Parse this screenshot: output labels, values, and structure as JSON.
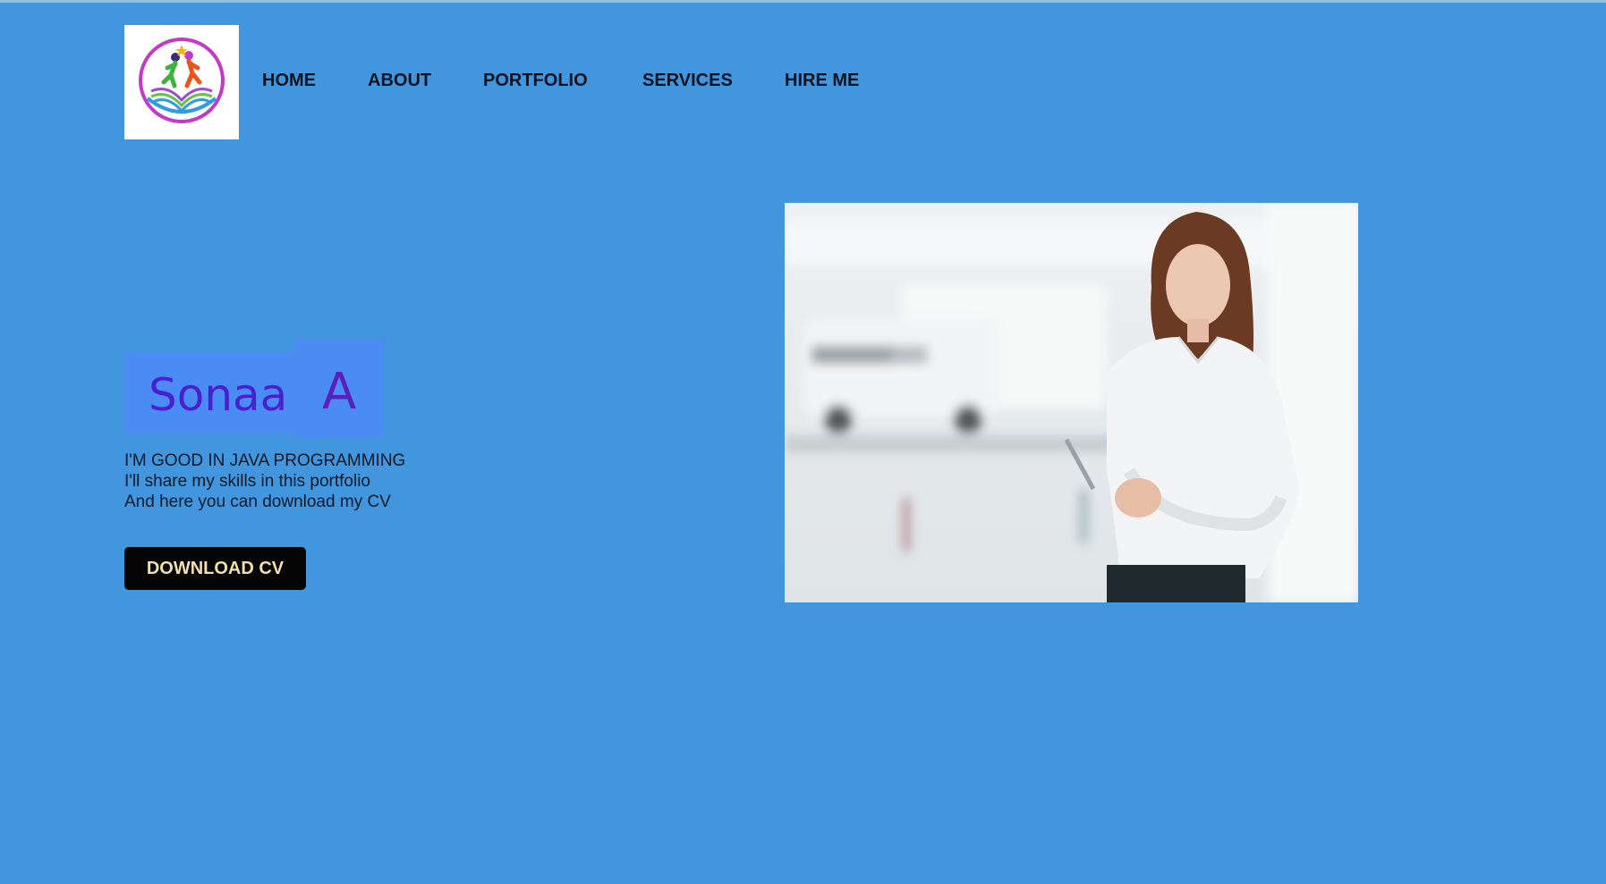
{
  "nav": {
    "items": [
      {
        "label": "HOME"
      },
      {
        "label": "ABOUT"
      },
      {
        "label": "PORTFOLIO"
      },
      {
        "label": "SERVICES"
      },
      {
        "label": "HIRE ME"
      }
    ]
  },
  "hero": {
    "first_name": "Sonaa",
    "last_name": "A",
    "tagline": [
      "I'M GOOD IN JAVA PROGRAMMING",
      "I'll share my skills in this portfolio",
      "And here you can download my CV"
    ],
    "cta_label": "DOWNLOAD CV"
  },
  "colors": {
    "background": "#4196de",
    "name_box": "#4a8cf4",
    "name_text": "#4a1fcf",
    "button_bg": "#050505",
    "button_text": "#f3dfae"
  },
  "icons": {
    "logo": "open-book-with-figures-logo"
  }
}
